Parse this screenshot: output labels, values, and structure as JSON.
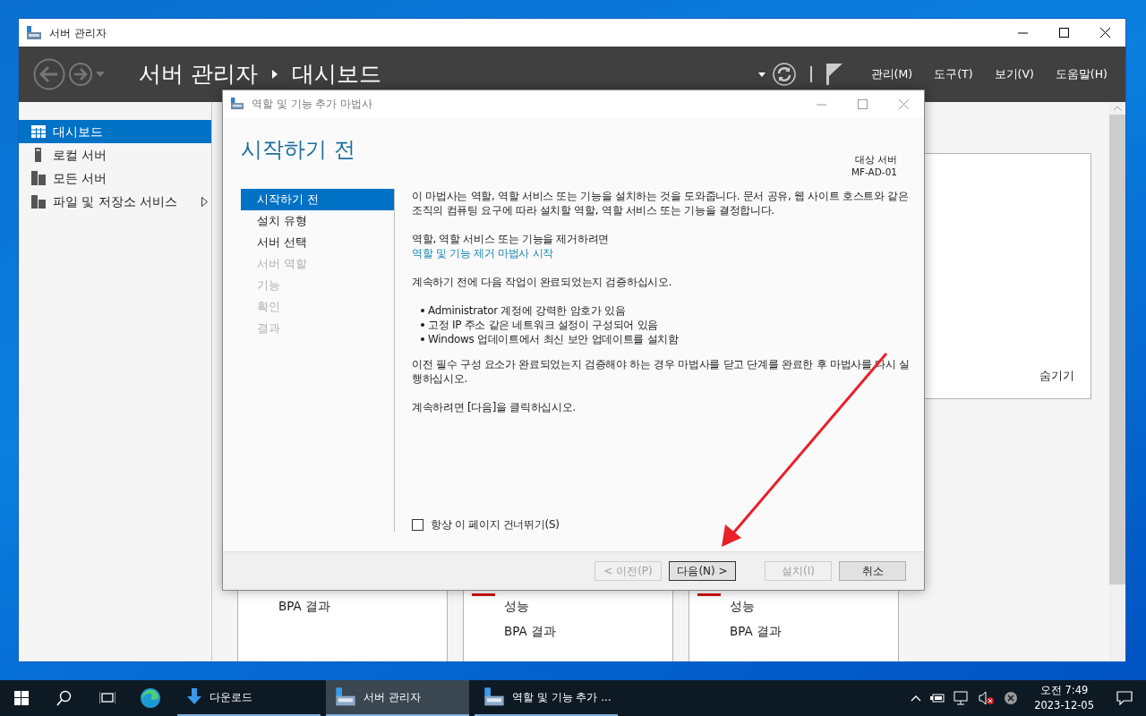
{
  "window": {
    "title": "서버 관리자"
  },
  "header": {
    "breadcrumb": [
      "서버 관리자",
      "대시보드"
    ],
    "menus": [
      "관리(M)",
      "도구(T)",
      "보기(V)",
      "도움말(H)"
    ]
  },
  "sidebar": {
    "items": [
      {
        "label": "대시보드",
        "kind": "dashboard",
        "selected": true,
        "expandable": false
      },
      {
        "label": "로컬 서버",
        "kind": "server",
        "selected": false,
        "expandable": false
      },
      {
        "label": "모든 서버",
        "kind": "servers",
        "selected": false,
        "expandable": false
      },
      {
        "label": "파일 및 저장소 서비스",
        "kind": "storage",
        "selected": false,
        "expandable": true
      }
    ]
  },
  "dashboard": {
    "panel": {
      "link": "숨기기"
    },
    "tiles": [
      {
        "alert": false,
        "lines": [
          "BPA 결과"
        ]
      },
      {
        "alert": true,
        "lines": [
          "성능",
          "BPA 결과"
        ]
      },
      {
        "alert": true,
        "lines": [
          "성능",
          "BPA 결과"
        ]
      }
    ]
  },
  "dialog": {
    "title": "역할 및 기능 추가 마법사",
    "heading": "시작하기 전",
    "target_label": "대상 서버",
    "target_server": "MF-AD-01",
    "steps": [
      {
        "label": "시작하기 전",
        "selected": true,
        "disabled": false
      },
      {
        "label": "설치 유형",
        "selected": false,
        "disabled": false
      },
      {
        "label": "서버 선택",
        "selected": false,
        "disabled": false
      },
      {
        "label": "서버 역할",
        "selected": false,
        "disabled": true
      },
      {
        "label": "기능",
        "selected": false,
        "disabled": true
      },
      {
        "label": "확인",
        "selected": false,
        "disabled": true
      },
      {
        "label": "결과",
        "selected": false,
        "disabled": true
      }
    ],
    "content": [
      {
        "kind": "paragraph",
        "text": "이 마법사는 역할, 역할 서비스 또는 기능을 설치하는 것을 도와줍니다. 문서 공유, 웹 사이트 호스트와 같은 조직의 컴퓨팅 요구에 따라 설치할 역할, 역할 서비스 또는 기능을 결정합니다."
      },
      {
        "kind": "link",
        "text": "역할, 역할 서비스 또는 기능을 제거하려면",
        "link": "역할 및 기능 제거 마법사 시작"
      },
      {
        "kind": "paragraph",
        "text": "계속하기 전에 다음 작업이 완료되었는지 검증하십시오."
      },
      {
        "kind": "bullets",
        "items": [
          "Administrator 계정에 강력한 암호가 있음",
          "고정 IP 주소 같은 네트워크 설정이 구성되어 있음",
          "Windows 업데이트에서 최신 보안 업데이트를 설치함"
        ]
      },
      {
        "kind": "paragraph",
        "text": "이전 필수 구성 요소가 완료되었는지 검증해야 하는 경우 마법사를 닫고 단계를 완료한 후 마법사를 다시 실행하십시오."
      },
      {
        "kind": "paragraph",
        "text": "계속하려면 [다음]을 클릭하십시오."
      }
    ],
    "checkbox": {
      "label": "항상 이 페이지 건너뛰기(S)",
      "checked": false
    },
    "buttons": [
      {
        "label": "< 이전(P)",
        "disabled": true,
        "default": false
      },
      {
        "label": "다음(N) >",
        "disabled": false,
        "default": true
      },
      {
        "label": "설치(I)",
        "disabled": true,
        "default": false
      },
      {
        "label": "취소",
        "disabled": false,
        "default": false
      }
    ]
  },
  "annotation": {
    "kind": "arrow"
  },
  "taskbar": {
    "apps": [
      {
        "label": "다운로드",
        "kind": "download",
        "active": false
      },
      {
        "label": "서버 관리자",
        "kind": "server-manager",
        "active": true
      },
      {
        "label": "역할 및 기능 추가 ...",
        "kind": "server-manager",
        "active": false
      }
    ],
    "clock": {
      "time": "오전 7:49",
      "date": "2023-12-05"
    }
  }
}
